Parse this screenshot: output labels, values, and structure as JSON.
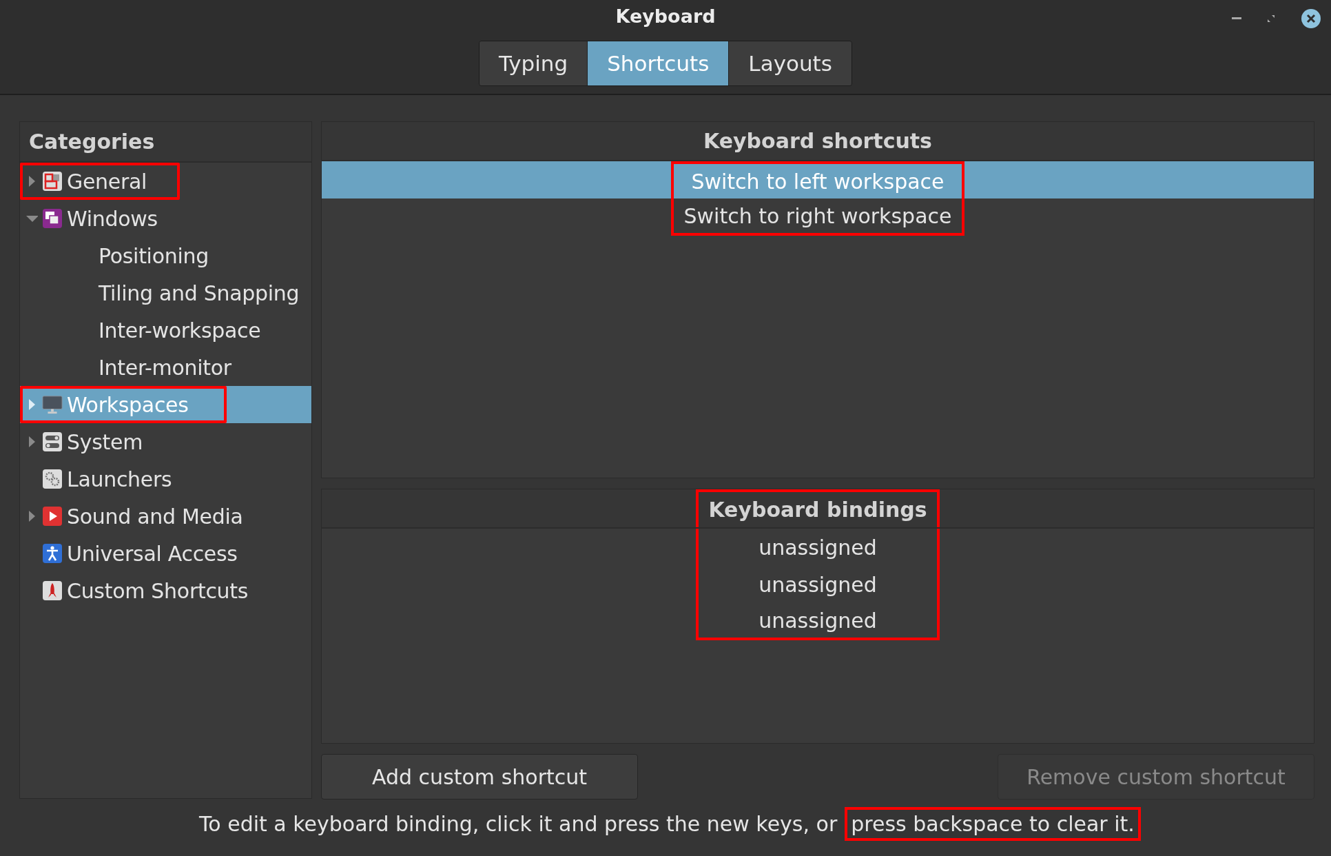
{
  "window": {
    "title": "Keyboard"
  },
  "tabs": [
    {
      "label": "Typing",
      "selected": false
    },
    {
      "label": "Shortcuts",
      "selected": true
    },
    {
      "label": "Layouts",
      "selected": false
    }
  ],
  "categories": {
    "header": "Categories",
    "items": [
      {
        "label": "General",
        "expandable": true,
        "expanded": false,
        "selected": false,
        "highlighted": true
      },
      {
        "label": "Windows",
        "expandable": true,
        "expanded": true,
        "selected": false,
        "highlighted": false,
        "children": [
          {
            "label": "Positioning",
            "selected": false
          },
          {
            "label": "Tiling and Snapping",
            "selected": false
          },
          {
            "label": "Inter-workspace",
            "selected": false
          },
          {
            "label": "Inter-monitor",
            "selected": false
          }
        ]
      },
      {
        "label": "Workspaces",
        "expandable": true,
        "expanded": false,
        "selected": true,
        "highlighted": true
      },
      {
        "label": "System",
        "expandable": true,
        "expanded": false,
        "selected": false,
        "highlighted": false
      },
      {
        "label": "Launchers",
        "expandable": false,
        "selected": false,
        "highlighted": false
      },
      {
        "label": "Sound and Media",
        "expandable": true,
        "expanded": false,
        "selected": false,
        "highlighted": false
      },
      {
        "label": "Universal Access",
        "expandable": false,
        "selected": false,
        "highlighted": false
      },
      {
        "label": "Custom Shortcuts",
        "expandable": false,
        "selected": false,
        "highlighted": false
      }
    ]
  },
  "shortcuts": {
    "header": "Keyboard shortcuts",
    "highlighted": true,
    "rows": [
      {
        "label": "Switch to left workspace",
        "selected": true
      },
      {
        "label": "Switch to right workspace",
        "selected": false
      }
    ]
  },
  "bindings": {
    "header": "Keyboard bindings",
    "highlighted": true,
    "rows": [
      {
        "label": "unassigned",
        "selected": false
      },
      {
        "label": "unassigned",
        "selected": false
      },
      {
        "label": "unassigned",
        "selected": false
      }
    ]
  },
  "buttons": [
    {
      "label": "Add custom shortcut",
      "disabled": false
    },
    {
      "label": "Remove custom shortcut",
      "disabled": true
    }
  ],
  "footer": [
    {
      "text": "To edit a keyboard binding, click it and press the new keys, or",
      "highlighted": false
    },
    {
      "text": "press backspace to clear it.",
      "highlighted": true
    }
  ]
}
